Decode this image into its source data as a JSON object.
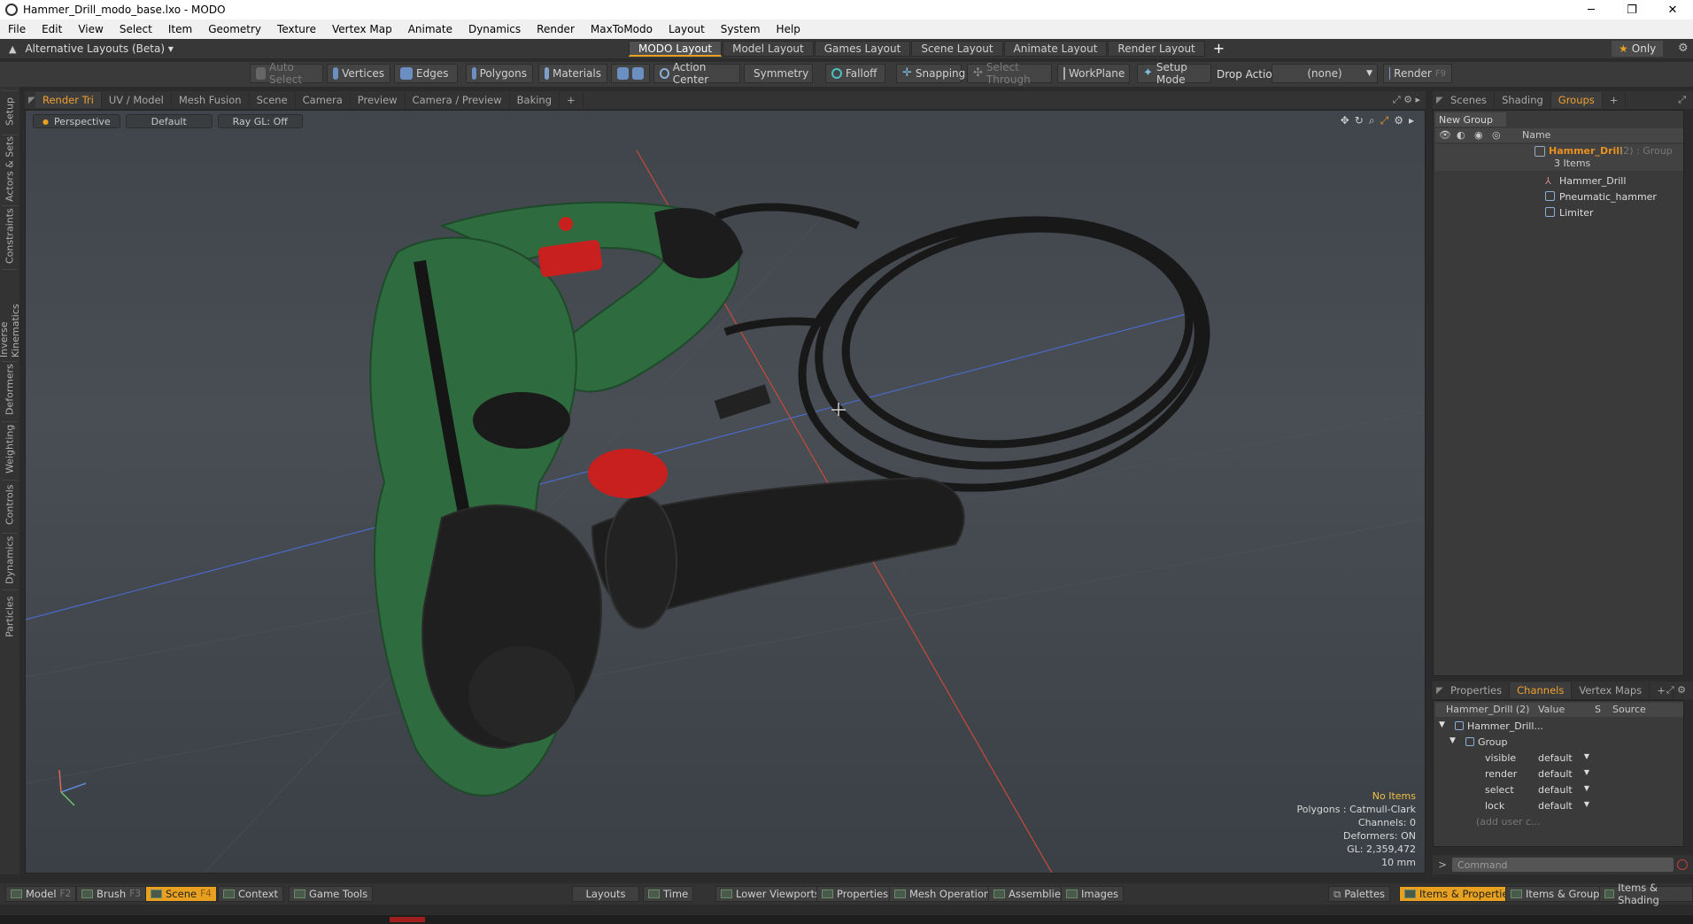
{
  "window": {
    "title": "Hammer_Drill_modo_base.lxo - MODO",
    "minimize": "─",
    "restore": "❐",
    "close": "✕"
  },
  "menu": [
    "File",
    "Edit",
    "View",
    "Select",
    "Item",
    "Geometry",
    "Texture",
    "Vertex Map",
    "Animate",
    "Dynamics",
    "Render",
    "MaxToModo",
    "Layout",
    "System",
    "Help"
  ],
  "layouts": {
    "alt_label": "Alternative Layouts (Beta)",
    "tabs": [
      "MODO Layout",
      "Model Layout",
      "Games Layout",
      "Scene Layout",
      "Animate Layout",
      "Render Layout"
    ],
    "active": "MODO Layout",
    "add": "+",
    "only": "Only"
  },
  "toolbar": {
    "auto_select": "Auto Select",
    "vertices": "Vertices",
    "edges": "Edges",
    "polygons": "Polygons",
    "materials": "Materials",
    "action_center": "Action Center",
    "symmetry": "Symmetry",
    "falloff": "Falloff",
    "snapping": "Snapping",
    "select_through": "Select Through",
    "workplane": "WorkPlane",
    "setup_mode": "Setup Mode",
    "drop_action": "Drop Action",
    "drop_value": "(none)",
    "render": "Render",
    "render_key": "F9"
  },
  "left_tabs": [
    "Setup",
    "Actors & Sets",
    "Constraints",
    "Inverse Kinematics",
    "Deformers",
    "Weighting",
    "Controls",
    "Dynamics",
    "Particles"
  ],
  "viewport_tabs": [
    "Render Tri",
    "UV / Model",
    "Mesh Fusion",
    "Scene",
    "Camera",
    "Preview",
    "Camera / Preview",
    "Baking"
  ],
  "viewport_tab_active": "Render Tri",
  "viewport": {
    "view": "Perspective",
    "shading": "Default",
    "raygl": "Ray GL: Off",
    "info": {
      "items": "No Items",
      "polygons": "Polygons : Catmull-Clark",
      "channels": "Channels: 0",
      "deformers": "Deformers: ON",
      "gl": "GL: 2,359,472",
      "scale": "10 mm"
    }
  },
  "right_tabs": [
    "Scenes",
    "Shading",
    "Groups"
  ],
  "right_tab_active": "Groups",
  "groups": {
    "new_group": "New Group",
    "col_name": "Name",
    "root": {
      "name": "Hammer_Drill",
      "suffix": "(2) : Group",
      "count": "3 Items"
    },
    "children": [
      "Hammer_Drill",
      "Pneumatic_hammer",
      "Limiter"
    ]
  },
  "channel_tabs": [
    "Properties",
    "Channels",
    "Vertex Maps"
  ],
  "channel_tab_active": "Channels",
  "channels": {
    "head_name": "Hammer_Drill (2)",
    "head_value": "Value",
    "head_s": "S",
    "head_source": "Source",
    "item": "Hammer_Drill...",
    "group": "Group",
    "rows": [
      {
        "name": "visible",
        "value": "default"
      },
      {
        "name": "render",
        "value": "default"
      },
      {
        "name": "select",
        "value": "default"
      },
      {
        "name": "lock",
        "value": "default"
      }
    ],
    "add_user": "(add user c..."
  },
  "command": {
    "placeholder": "Command",
    "prompt": ">"
  },
  "bottom": {
    "model": "Model",
    "model_key": "F2",
    "brush": "Brush",
    "brush_key": "F3",
    "scene": "Scene",
    "scene_key": "F4",
    "context": "Context",
    "game_tools": "Game Tools",
    "layouts": "Layouts",
    "time": "Time",
    "lower_viewports": "Lower Viewports",
    "properties": "Properties",
    "mesh_operations": "Mesh Operations",
    "assemblies": "Assemblies",
    "images": "Images",
    "palettes": "Palettes",
    "items_properties": "Items & Properties",
    "items_groups": "Items & Groups",
    "items_shading": "Items & Shading"
  },
  "colors": {
    "accent": "#e8a020",
    "hammer_green": "#2e6b3e",
    "hammer_red": "#c8201e",
    "cord": "#1c1c1c"
  }
}
